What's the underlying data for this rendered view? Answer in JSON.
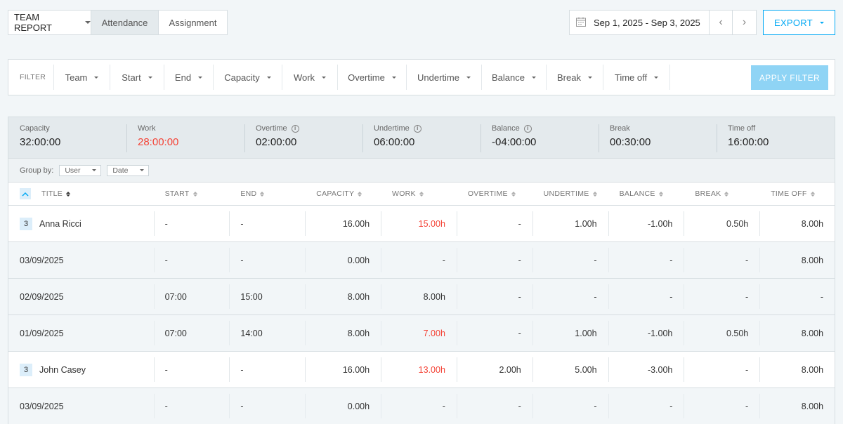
{
  "topbar": {
    "report_label": "TEAM REPORT",
    "tabs": [
      "Attendance",
      "Assignment"
    ],
    "date_range": "Sep 1, 2025 - Sep 3, 2025",
    "prev": "‹",
    "next": "›",
    "export_label": "EXPORT"
  },
  "filter": {
    "label": "FILTER",
    "items": [
      "Team",
      "Start",
      "End",
      "Capacity",
      "Work",
      "Overtime",
      "Undertime",
      "Balance",
      "Break",
      "Time off"
    ],
    "apply_label": "APPLY FILTER"
  },
  "summary": [
    {
      "label": "Capacity",
      "value": "32:00:00"
    },
    {
      "label": "Work",
      "value": "28:00:00"
    },
    {
      "label": "Overtime",
      "value": "02:00:00"
    },
    {
      "label": "Undertime",
      "value": "06:00:00"
    },
    {
      "label": "Balance",
      "value": "-04:00:00"
    },
    {
      "label": "Break",
      "value": "00:30:00"
    },
    {
      "label": "Time off",
      "value": "16:00:00"
    }
  ],
  "groupby": {
    "label": "Group by:",
    "first": "User",
    "second": "Date"
  },
  "table": {
    "headers": [
      "TITLE",
      "START",
      "END",
      "CAPACITY",
      "WORK",
      "OVERTIME",
      "UNDERTIME",
      "BALANCE",
      "BREAK",
      "TIME OFF"
    ],
    "rows": [
      {
        "badge": "3",
        "cells": [
          "Anna Ricci",
          "-",
          "-",
          "16.00h",
          "15.00h",
          "-",
          "1.00h",
          "-1.00h",
          "0.50h",
          "8.00h"
        ]
      },
      {
        "cells": [
          "03/09/2025",
          "-",
          "-",
          "0.00h",
          "-",
          "-",
          "-",
          "-",
          "-",
          "8.00h"
        ]
      },
      {
        "cells": [
          "02/09/2025",
          "07:00",
          "15:00",
          "8.00h",
          "8.00h",
          "-",
          "-",
          "-",
          "-",
          "-"
        ]
      },
      {
        "cells": [
          "01/09/2025",
          "07:00",
          "14:00",
          "8.00h",
          "7.00h",
          "-",
          "1.00h",
          "-1.00h",
          "0.50h",
          "8.00h"
        ]
      },
      {
        "badge": "3",
        "cells": [
          "John Casey",
          "-",
          "-",
          "16.00h",
          "13.00h",
          "2.00h",
          "5.00h",
          "-3.00h",
          "-",
          "8.00h"
        ]
      },
      {
        "cells": [
          "03/09/2025",
          "-",
          "-",
          "0.00h",
          "-",
          "-",
          "-",
          "-",
          "-",
          "8.00h"
        ]
      }
    ]
  },
  "colors": {
    "accent": "#03a9f4",
    "negative": "#f44336",
    "apply_disabled": "#8fd4f5"
  }
}
